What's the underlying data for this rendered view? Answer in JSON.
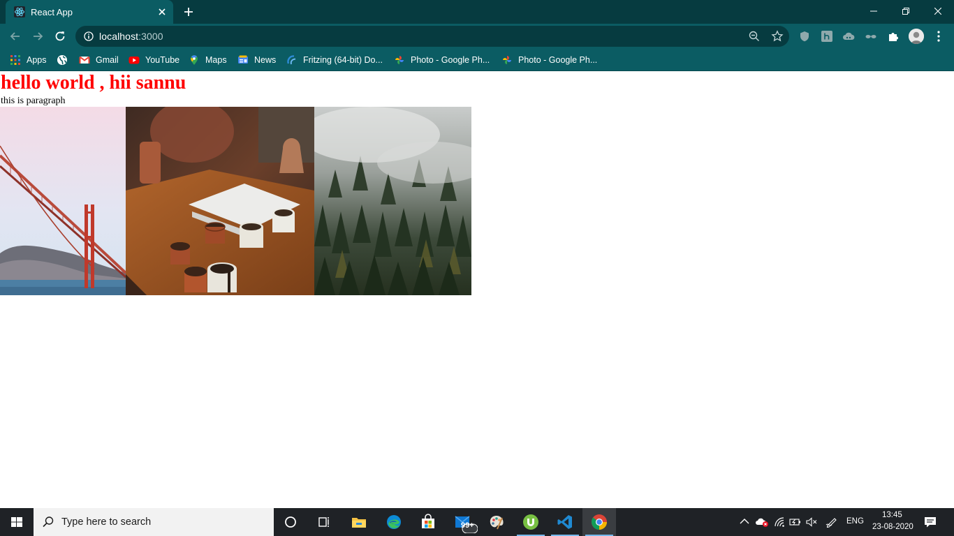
{
  "browser": {
    "tab_title": "React App",
    "url_host": "localhost",
    "url_port": ":3000"
  },
  "bookmarks": [
    {
      "label": "Apps",
      "icon": "apps-grid-icon"
    },
    {
      "label": "",
      "icon": "globe-icon"
    },
    {
      "label": "Gmail",
      "icon": "gmail-icon"
    },
    {
      "label": "YouTube",
      "icon": "youtube-icon"
    },
    {
      "label": "Maps",
      "icon": "maps-icon"
    },
    {
      "label": "News",
      "icon": "news-icon"
    },
    {
      "label": "Fritzing (64-bit) Do...",
      "icon": "fritzing-icon"
    },
    {
      "label": "Photo - Google Ph...",
      "icon": "google-photos-icon"
    },
    {
      "label": "Photo - Google Ph...",
      "icon": "google-photos-icon"
    }
  ],
  "page": {
    "heading": "hello world , hii sannu",
    "paragraph": "this is paragraph",
    "images": [
      {
        "subject": "golden-gate-bridge"
      },
      {
        "subject": "coffee-cups-on-table"
      },
      {
        "subject": "misty-forest"
      }
    ]
  },
  "taskbar": {
    "search_placeholder": "Type here to search",
    "mail_badge": "99+",
    "language": "ENG",
    "time": "13:45",
    "date": "23-08-2020"
  },
  "colors": {
    "chrome_dark": "#063b40",
    "chrome_mid": "#0b5c63",
    "heading_red": "#ff0000",
    "taskbar": "#1f2226",
    "taskbar_accent": "#76b9ed"
  }
}
